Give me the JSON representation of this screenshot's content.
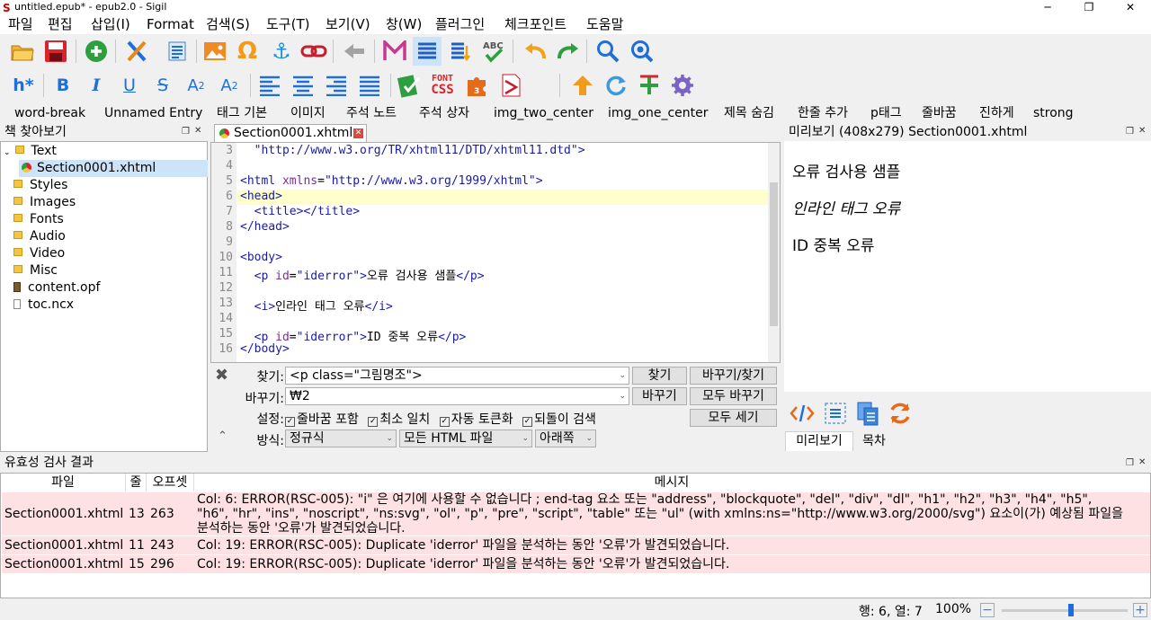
{
  "window": {
    "title": "untitled.epub* - epub2.0 - Sigil",
    "min_label": "─",
    "max_label": "❐",
    "close_label": "✕"
  },
  "menu": [
    "파일",
    "편집",
    "삽입(I)",
    "Format",
    "검색(S)",
    "도구(T)",
    "보기(V)",
    "창(W)",
    "플러그인",
    "체크포인트",
    "도움말"
  ],
  "toolbar1": [
    "open-icon",
    "save-icon",
    "add-file-icon",
    "cut-icon",
    "metadata-icon",
    "insert-image-icon",
    "special-char-icon",
    "anchor-icon",
    "link-icon",
    "back-icon",
    "meta-editor-icon",
    "toc-icon",
    "generate-toc-icon",
    "spellcheck-icon",
    "undo-icon",
    "redo-icon",
    "search-icon",
    "search-replace-icon"
  ],
  "toolbar2": {
    "heading_label": "h*",
    "bold": "B",
    "italic": "I",
    "underline": "U",
    "strike": "S",
    "subscript": "A",
    "subscript_mark": "2",
    "superscript": "A",
    "superscript_mark": "2",
    "font_css_top": "FONT",
    "font_css_bottom": "CSS"
  },
  "clips": [
    "word-break",
    "Unnamed Entry",
    "태그 기본",
    "이미지",
    "주석 노트",
    "주석 상자",
    "img_two_center",
    "img_one_center",
    "제목 숨김",
    "한줄 추가",
    "p태그",
    "줄바꿈",
    "진하게",
    "strong"
  ],
  "book_browser": {
    "title": "책 찾아보기",
    "items": [
      {
        "label": "Text",
        "expanded": true
      },
      {
        "label": "Section0001.xhtml",
        "selected": true
      },
      {
        "label": "Styles"
      },
      {
        "label": "Images"
      },
      {
        "label": "Fonts"
      },
      {
        "label": "Audio"
      },
      {
        "label": "Video"
      },
      {
        "label": "Misc"
      },
      {
        "label": "content.opf"
      },
      {
        "label": "toc.ncx"
      }
    ]
  },
  "editor": {
    "tab_label": "Section0001.xhtml",
    "line_numbers": [
      "3",
      "4",
      "5",
      "6",
      "7",
      "8",
      "9",
      "10",
      "11",
      "12",
      "13",
      "14",
      "15",
      "16"
    ],
    "lines": [
      "  \"http://www.w3.org/TR/xhtml11/DTD/xhtml11.dtd\">",
      "",
      "<html xmlns=\"http://www.w3.org/1999/xhtml\">",
      "<head>",
      "  <title></title>",
      "</head>",
      "",
      "<body>",
      "  <p id=\"iderror\">오류 검사용 샘플</p>",
      "",
      "  <i>인라인 태그 오류</i>",
      "",
      "  <p id=\"iderror\">ID 중복 오류</p>",
      "</body>"
    ],
    "current_line": "6"
  },
  "find_replace": {
    "find_label": "찾기:",
    "find_value": "<p class=\"그림명조\">",
    "replace_label": "바꾸기:",
    "replace_value": "₩2",
    "options_label": "설정:",
    "option_wrap": "줄바꿈 포함",
    "option_minimal": "최소 일치",
    "option_auto": "자동 토큰화",
    "option_reverse": "되돌이 검색",
    "mode_label": "방식:",
    "mode_value": "정규식",
    "scope_value": "모든 HTML 파일",
    "direction_value": "아래쪽",
    "find_button": "찾기",
    "replace_find_button": "바꾸기/찾기",
    "replace_button": "바꾸기",
    "replace_all_button": "모두 바꾸기",
    "count_all_button": "모두 세기"
  },
  "preview": {
    "title": "미리보기 (408x279) Section0001.xhtml",
    "lines": [
      "오류 검사용 샘플",
      "인라인 태그 오류",
      "ID 중복 오류"
    ],
    "tab_preview": "미리보기",
    "tab_toc": "목차"
  },
  "validation": {
    "title": "유효성 검사 결과",
    "headers": [
      "파일",
      "줄",
      "오프셋",
      "메시지"
    ],
    "rows": [
      {
        "file": "Section0001.xhtml",
        "line": "13",
        "offset": "263",
        "message_lines": [
          "Col: 6: ERROR(RSC-005): \"i\" 은 여기에 사용할 수 없습니다 ; end-tag 요소 또는 \"address\", \"blockquote\", \"del\", \"div\", \"dl\", \"h1\", \"h2\", \"h3\", \"h4\", \"h5\",",
          "\"h6\", \"hr\", \"ins\", \"noscript\", \"ns:svg\", \"ol\", \"p\", \"pre\", \"script\", \"table\" 또는 \"ul\" (with xmlns:ns=\"http://www.w3.org/2000/svg\") 요소이(가) 예상됨 파일을",
          "분석하는 동안 '오류'가 발견되었습니다."
        ]
      },
      {
        "file": "Section0001.xhtml",
        "line": "11",
        "offset": "243",
        "message_lines": [
          "Col: 19: ERROR(RSC-005): Duplicate 'iderror' 파일을 분석하는 동안 '오류'가 발견되었습니다."
        ]
      },
      {
        "file": "Section0001.xhtml",
        "line": "15",
        "offset": "296",
        "message_lines": [
          "Col: 19: ERROR(RSC-005): Duplicate 'iderror' 파일을 분석하는 동안 '오류'가 발견되었습니다."
        ]
      }
    ]
  },
  "status": {
    "position": "행: 6, 열: 7",
    "zoom": "100%",
    "zoom_level": 0.55
  },
  "colors": {
    "error_row": "#fde1e3",
    "current_line": "#ffffcc",
    "selection": "#cde3f7"
  }
}
